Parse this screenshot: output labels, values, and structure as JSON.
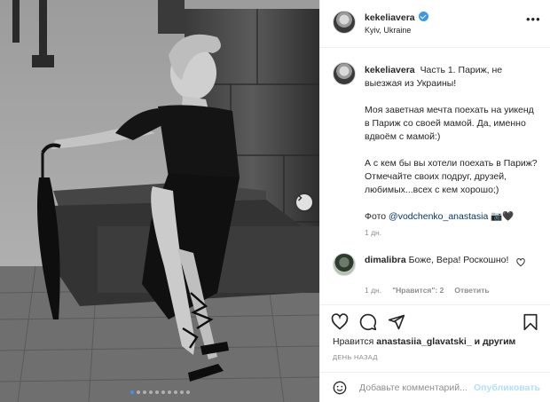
{
  "post": {
    "username": "kekeliavera",
    "location": "Kyiv, Ukraine",
    "caption": {
      "username": "kekeliavera",
      "line1": "Часть 1. Париж, не выезжая из Украины!",
      "line2": "Моя заветная мечта поехать на уикенд в Париж со своей мамой. Да, именно вдвоём с мамой:)",
      "line3": "А с кем бы вы хотели поехать в Париж? Отмечайте своих подруг, друзей, любимых...всех с кем хорошо;)",
      "credit_prefix": "Фото ",
      "credit_link": "@vodchenko_anastasia",
      "credit_emoji": "📷🖤",
      "time": "1 дн."
    },
    "comment": {
      "username": "dimalibra",
      "text": "Боже, Вера! Роскошно!",
      "time": "1 дн.",
      "likes": "\"Нравится\": 2",
      "reply": "Ответить"
    },
    "likes": {
      "prefix": "Нравится ",
      "user": "anastasiia_glavatski_",
      "suffix": " и другим"
    },
    "date": "ДЕНЬ НАЗАД",
    "add_comment": {
      "placeholder": "Добавьте комментарий...",
      "publish": "Опубликовать"
    },
    "carousel": {
      "count": 10,
      "active": 1
    }
  },
  "colors": {
    "accent": "#3897f0",
    "link": "#00376b",
    "muted": "#8e8e8e",
    "publish_disabled": "#b2dffc"
  },
  "icons": [
    "more-icon",
    "verified-icon",
    "heart-icon",
    "comment-icon",
    "share-icon",
    "bookmark-icon",
    "emoji-icon",
    "chevron-right-icon"
  ]
}
